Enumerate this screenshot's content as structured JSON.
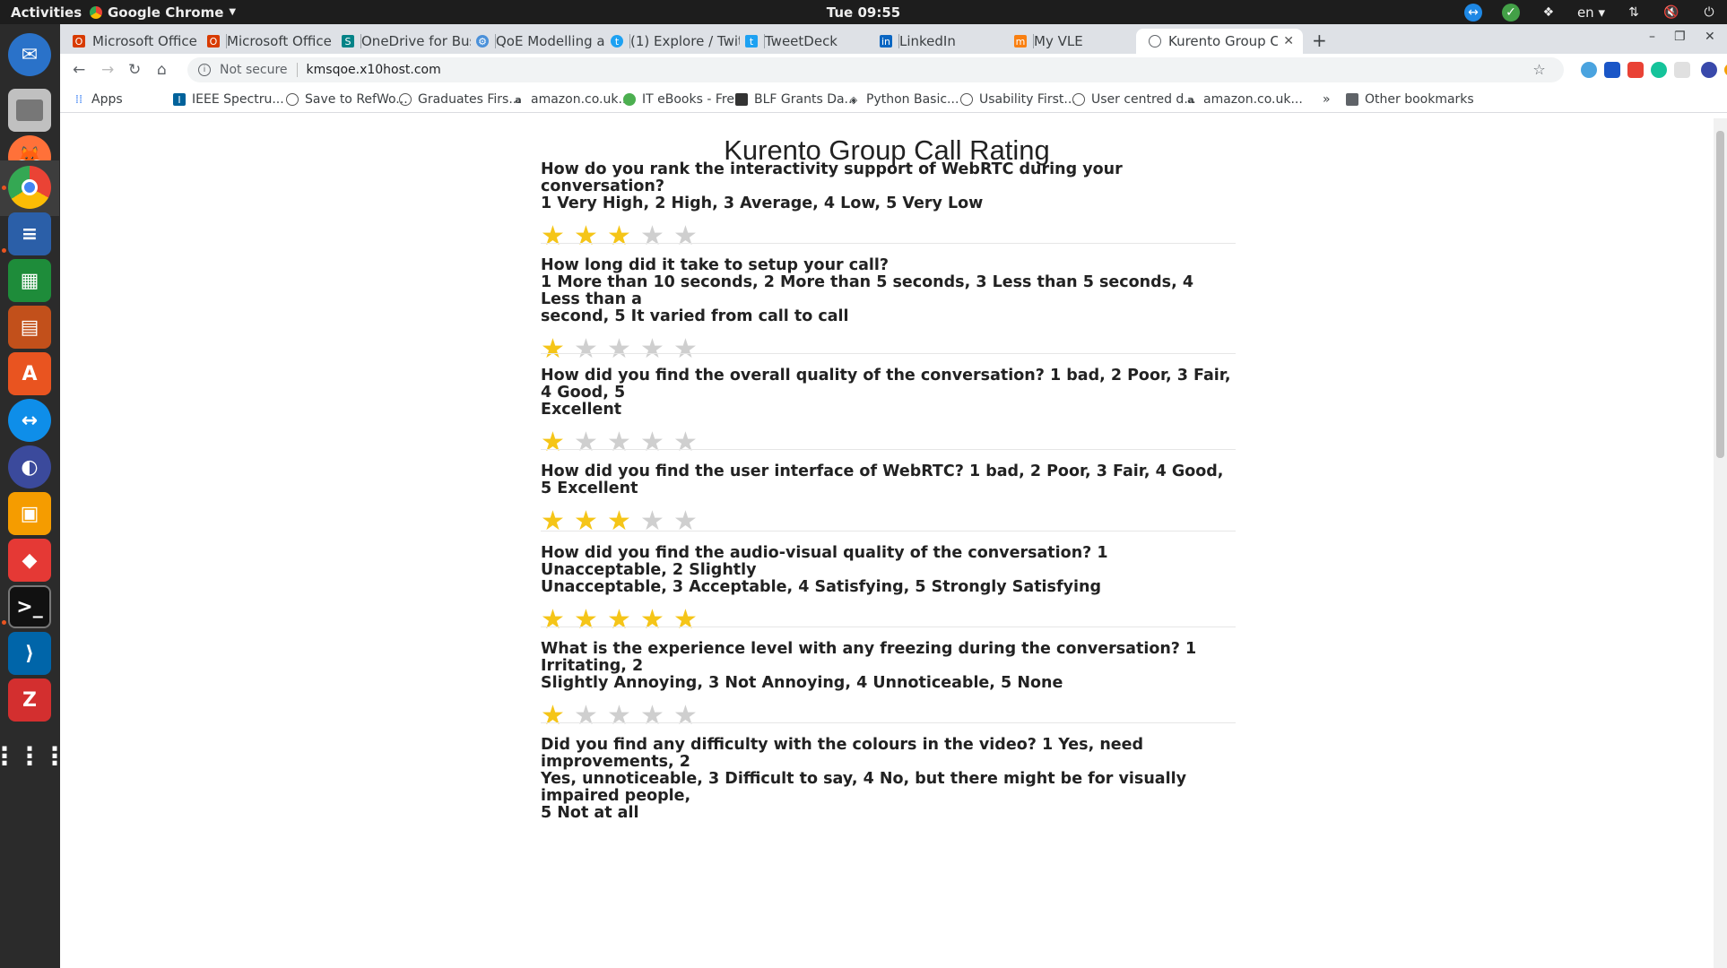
{
  "topbar": {
    "activities": "Activities",
    "app_name": "Google Chrome",
    "clock": "Tue 09:55",
    "lang": "en"
  },
  "tabs": [
    {
      "title": "Microsoft Office H",
      "icon": "office-icon",
      "color": "#d83b01"
    },
    {
      "title": "Microsoft Office H",
      "icon": "office-icon",
      "color": "#d83b01"
    },
    {
      "title": "OneDrive for Busi",
      "icon": "sharepoint-icon",
      "color": "#038387"
    },
    {
      "title": "QoE Modelling an",
      "icon": "gear-icon",
      "color": "#4a90d9"
    },
    {
      "title": "(1) Explore / Twit",
      "icon": "twitter-icon",
      "color": "#1da1f2"
    },
    {
      "title": "TweetDeck",
      "icon": "tweetdeck-icon",
      "color": "#1da1f2"
    },
    {
      "title": "LinkedIn",
      "icon": "linkedin-icon",
      "color": "#0a66c2"
    },
    {
      "title": "My VLE",
      "icon": "moodle-icon",
      "color": "#f98012"
    },
    {
      "title": "Kurento Group Ca",
      "icon": "globe-icon",
      "color": "#5f6368"
    }
  ],
  "address": {
    "security": "Not secure",
    "url": "kmsqoe.x10host.com"
  },
  "bookmarks": {
    "apps": "Apps",
    "items": [
      "IEEE Spectru...",
      "Save to RefWo...",
      "Graduates Firs...",
      "amazon.co.uk...",
      "IT eBooks - Fre...",
      "BLF Grants Da...",
      "Python Basic...",
      "Usability First...",
      "User centred d...",
      "amazon.co.uk..."
    ],
    "more": "»",
    "other": "Other bookmarks"
  },
  "page": {
    "title": "Kurento Group Call Rating",
    "questions": [
      {
        "lines": [
          "How do you rank the interactivity support of WebRTC during your conversation?",
          "1 Very High, 2 High, 3 Average, 4 Low, 5 Very Low"
        ],
        "rating": 3,
        "max": 5
      },
      {
        "lines": [
          "How long did it take to setup your call?",
          "1 More than 10 seconds, 2 More than 5 seconds, 3 Less than 5 seconds, 4 Less than a",
          "second, 5 It varied from call to call"
        ],
        "rating": 1,
        "max": 5
      },
      {
        "lines": [
          "How did you find the overall quality of the conversation? 1 bad, 2 Poor, 3 Fair, 4 Good, 5",
          "Excellent"
        ],
        "rating": 1,
        "max": 5
      },
      {
        "lines": [
          "How did you find the user interface of WebRTC? 1 bad, 2 Poor, 3 Fair, 4 Good, 5 Excellent"
        ],
        "rating": 3,
        "max": 5
      },
      {
        "lines": [
          "How did you find the audio-visual quality of the conversation? 1 Unacceptable, 2 Slightly",
          "Unacceptable, 3 Acceptable, 4 Satisfying, 5 Strongly Satisfying"
        ],
        "rating": 5,
        "max": 5
      },
      {
        "lines": [
          "What is the experience level with any freezing during the conversation? 1 Irritating, 2",
          "Slightly Annoying, 3 Not Annoying, 4 Unnoticeable, 5 None"
        ],
        "rating": 1,
        "max": 5
      },
      {
        "lines": [
          "Did you find any difficulty with the colours in the video? 1 Yes, need improvements, 2",
          "Yes, unnoticeable, 3 Difficult to say, 4 No, but there might be for visually impaired people,",
          "5 Not at all"
        ],
        "rating": 0,
        "max": 5
      }
    ]
  },
  "colors": {
    "star_on": "#f5c518",
    "star_off": "#cfcfcf",
    "accent_dock": "#e95420"
  }
}
